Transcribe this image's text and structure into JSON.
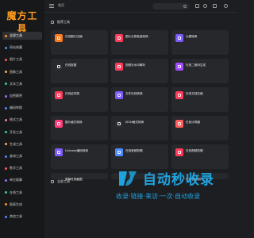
{
  "app": {
    "logo": "魔方工具",
    "accent": "#ff9a1e"
  },
  "sidebar": {
    "items": [
      {
        "label": "全部工具",
        "color": "#ff9a1e",
        "active": true
      },
      {
        "label": "网站收藏",
        "color": "#4c8dff"
      },
      {
        "label": "图片工具",
        "color": "#ff5c5c"
      },
      {
        "label": "图像工具",
        "color": "#ffb23f"
      },
      {
        "label": "文本工具",
        "color": "#3ecf8e"
      },
      {
        "label": "加密解密",
        "color": "#a26bff"
      },
      {
        "label": "编码转换",
        "color": "#4c8dff"
      },
      {
        "label": "格式工具",
        "color": "#ff6fb1"
      },
      {
        "label": "开发工具",
        "color": "#3ecf8e"
      },
      {
        "label": "生成工具",
        "color": "#ffb23f"
      },
      {
        "label": "查询工具",
        "color": "#4c8dff"
      },
      {
        "label": "数字工具",
        "color": "#ff5c5c"
      },
      {
        "label": "单位换算",
        "color": "#a26bff"
      },
      {
        "label": "在线工具",
        "color": "#3ecf8e"
      },
      {
        "label": "图表生成",
        "color": "#ff9a1e"
      },
      {
        "label": "其他工具",
        "color": "#4c8dff"
      }
    ]
  },
  "topbar": {
    "home": "首页"
  },
  "sections": [
    {
      "title": "推荐工具"
    },
    {
      "title": "全部工具"
    }
  ],
  "cards": [
    {
      "title": "在线图片压缩",
      "desc": "",
      "color": "#ff7a1a"
    },
    {
      "title": "图片无损批量转换",
      "desc": "",
      "color": "#ff3b5c"
    },
    {
      "title": "大图转换",
      "desc": "",
      "color": "#7c5cff"
    },
    {
      "title": "在线抠图",
      "desc": "",
      "color": "#2b2c30"
    },
    {
      "title": "视频去水印解析",
      "desc": "",
      "color": "#ff3b5c"
    },
    {
      "title": "在线二维码生成",
      "desc": "",
      "color": "#a34bff"
    },
    {
      "title": "在线证件照",
      "desc": "",
      "color": "#ff3b5c"
    },
    {
      "title": "文件在线转换",
      "desc": "",
      "color": "#7c5cff"
    },
    {
      "title": "在线文档压缩",
      "desc": "",
      "color": "#ff3b5c"
    },
    {
      "title": "图片格式转换",
      "desc": "",
      "color": "#ff3b7a"
    },
    {
      "title": "JSON格式转换",
      "desc": "",
      "color": "#2b2c30"
    },
    {
      "title": "在线计算器",
      "desc": "",
      "color": "#ff5c5c"
    },
    {
      "title": "Unicode编码转换",
      "desc": "",
      "color": "#7c5cff"
    },
    {
      "title": "在线音频剪辑",
      "desc": "",
      "color": "#4c8dff"
    },
    {
      "title": "在线视频剪辑",
      "desc": "",
      "color": "#ff3b5c"
    },
    {
      "title": "屏幕在线截图",
      "desc": "",
      "color": "#3ecf8e"
    },
    {
      "title": "",
      "desc": "",
      "color": "#2b2c30"
    },
    {
      "title": "",
      "desc": "",
      "color": "#2b2c30"
    },
    {
      "title": "在线表格制作",
      "desc": "",
      "color": "#7c5cff"
    }
  ],
  "watermark": {
    "title": "自动秒收录",
    "subtitle": "收录·链接·来访·一次·自动收录"
  }
}
